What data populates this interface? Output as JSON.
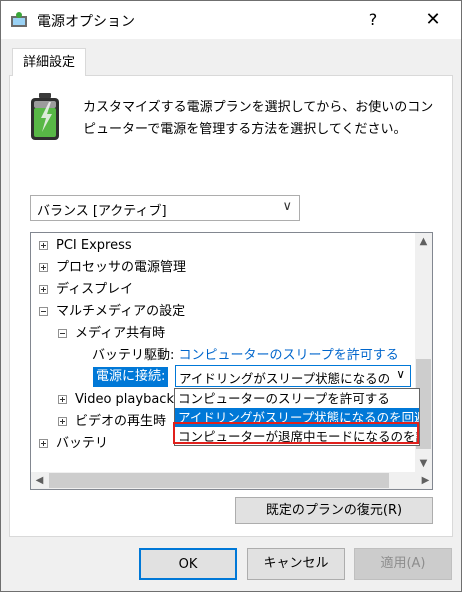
{
  "window": {
    "title": "電源オプション",
    "help": "?",
    "close": "✕"
  },
  "tab": {
    "label": "詳細設定"
  },
  "description": "カスタマイズする電源プランを選択してから、お使いのコンピューターで電源を管理する方法を選択してください。",
  "plan_select": {
    "value": "バランス [アクティブ]"
  },
  "tree": {
    "items": [
      {
        "label": "PCI Express",
        "state": "collapsed"
      },
      {
        "label": "プロセッサの電源管理",
        "state": "collapsed"
      },
      {
        "label": "ディスプレイ",
        "state": "collapsed"
      },
      {
        "label": "マルチメディアの設定",
        "state": "expanded"
      },
      {
        "label": "メディア共有時",
        "state": "expanded"
      },
      {
        "label": "Video playback",
        "state": "collapsed"
      },
      {
        "label": "ビデオの再生時",
        "state": "collapsed"
      },
      {
        "label": "バッテリ",
        "state": "collapsed"
      }
    ],
    "battery_setting": {
      "label": "バッテリ駆動:",
      "value": "コンピューターのスリープを許可する"
    },
    "plugged_setting": {
      "label": "電源に接続:",
      "value": "アイドリングがスリープ状態になるのを回避"
    }
  },
  "dropdown": {
    "options": [
      "コンピューターのスリープを許可する",
      "アイドリングがスリープ状態になるのを回避する",
      "コンピューターが退席中モードになるのを許可する"
    ],
    "selected_index": 1,
    "highlighted_index": 2
  },
  "restore_button": "既定のプランの復元(R)",
  "buttons": {
    "ok": "OK",
    "cancel": "キャンセル",
    "apply": "適用(A)"
  },
  "colors": {
    "accent": "#0078d7",
    "link": "#0066cc",
    "highlight_border": "#e0201c"
  }
}
